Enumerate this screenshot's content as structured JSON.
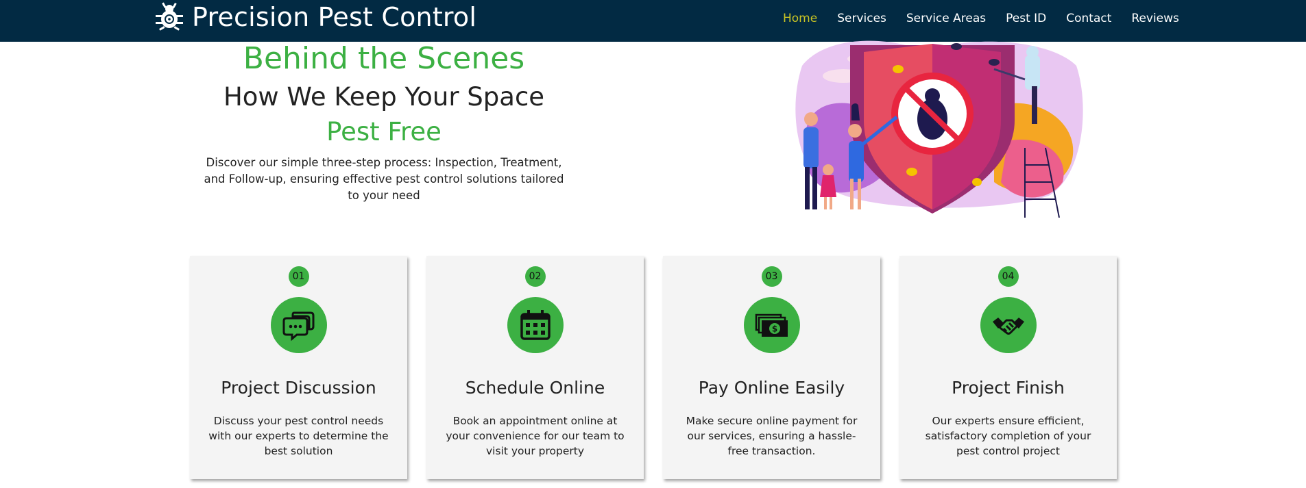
{
  "brand": {
    "name": "Precision Pest Control",
    "icon": "bug-target-icon"
  },
  "nav": {
    "items": [
      {
        "label": "Home",
        "active": true
      },
      {
        "label": "Services",
        "active": false
      },
      {
        "label": "Service Areas",
        "active": false
      },
      {
        "label": "Pest ID",
        "active": false
      },
      {
        "label": "Contact",
        "active": false
      },
      {
        "label": "Reviews",
        "active": false
      }
    ]
  },
  "hero": {
    "title": "Behind the Scenes",
    "subtitle": "How We Keep Your Space",
    "subtitle2": "Pest Free",
    "description": "Discover our simple three-step process: Inspection, Treatment, and Follow-up, ensuring effective pest control solutions tailored to your need"
  },
  "steps": [
    {
      "number": "01",
      "icon": "chat-bubbles-icon",
      "title": "Project Discussion",
      "description": "Discuss your pest control needs with our experts to determine the best solution"
    },
    {
      "number": "02",
      "icon": "calendar-icon",
      "title": "Schedule Online",
      "description": "Book an appointment online at your convenience for our team to visit your property"
    },
    {
      "number": "03",
      "icon": "money-icon",
      "title": "Pay Online Easily",
      "description": "Make secure online payment for our services, ensuring a hassle-free transaction."
    },
    {
      "number": "04",
      "icon": "handshake-icon",
      "title": "Project Finish",
      "description": "Our experts ensure efficient, satisfactory completion of your pest control project"
    }
  ],
  "colors": {
    "navbar": "#022a43",
    "accent_green": "#3cb043",
    "active_nav": "#c9c424",
    "card_bg": "#f4f4f4"
  }
}
